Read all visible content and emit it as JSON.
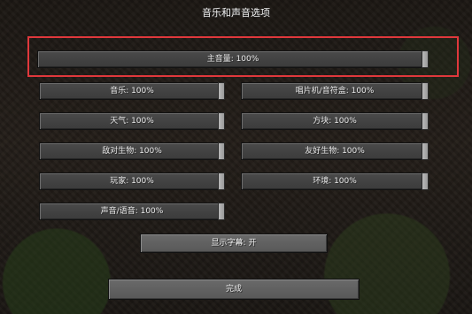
{
  "screen": {
    "title": "音乐和声音选项"
  },
  "master": {
    "label": "主音量: 100%",
    "value": 100
  },
  "sliders": [
    {
      "label": "音乐: 100%",
      "value": 100
    },
    {
      "label": "唱片机/音符盒: 100%",
      "value": 100
    },
    {
      "label": "天气: 100%",
      "value": 100
    },
    {
      "label": "方块: 100%",
      "value": 100
    },
    {
      "label": "敌对生物: 100%",
      "value": 100
    },
    {
      "label": "友好生物: 100%",
      "value": 100
    },
    {
      "label": "玩家: 100%",
      "value": 100
    },
    {
      "label": "环境: 100%",
      "value": 100
    },
    {
      "label": "声音/语音: 100%",
      "value": 100
    }
  ],
  "subtitles": {
    "label": "显示字幕: 开"
  },
  "done": {
    "label": "完成"
  },
  "highlight_color": "#e0383c"
}
